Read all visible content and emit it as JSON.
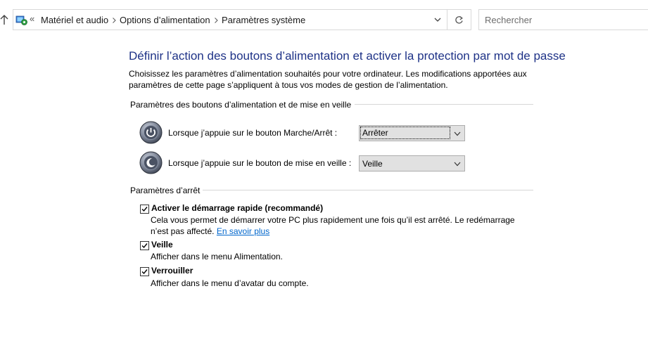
{
  "address_bar": {
    "breadcrumb_overflow": "«",
    "crumbs": [
      "Matériel et audio",
      "Options d’alimentation",
      "Paramètres système"
    ],
    "search_placeholder": "Rechercher"
  },
  "page": {
    "title": "Définir l’action des boutons d’alimentation et activer la protection par mot de passe",
    "intro": "Choisissez les paramètres d’alimentation souhaités pour votre ordinateur. Les modifications apportées aux paramètres de cette page s’appliquent à tous vos modes de gestion de l’alimentation."
  },
  "power_buttons": {
    "heading": "Paramètres des boutons d’alimentation et de mise en veille",
    "power_button_label": "Lorsque j’appuie sur le bouton Marche/Arrêt :",
    "power_button_value": "Arrêter",
    "sleep_button_label": "Lorsque j’appuie sur le bouton de mise en veille :",
    "sleep_button_value": "Veille"
  },
  "shutdown": {
    "heading": "Paramètres d’arrêt",
    "fast_startup": {
      "label": "Activer le démarrage rapide (recommandé)",
      "desc": "Cela vous permet de démarrer votre PC plus rapidement une fois qu’il est arrêté. Le redémarrage n’est pas affecté.",
      "link": "En savoir plus",
      "checked": true
    },
    "sleep": {
      "label": "Veille",
      "desc": "Afficher dans le menu Alimentation.",
      "checked": true
    },
    "lock": {
      "label": "Verrouiller",
      "desc": "Afficher dans le menu d’avatar du compte.",
      "checked": true
    }
  },
  "colors": {
    "title": "#1e3287",
    "link": "#0066cc",
    "separator": "#d7d7d7"
  }
}
